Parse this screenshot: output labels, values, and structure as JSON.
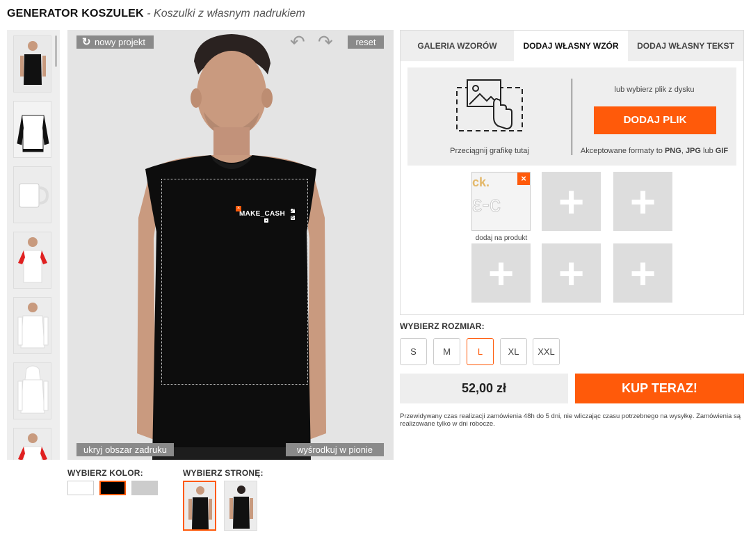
{
  "header": {
    "title": "GENERATOR KOSZULEK",
    "subtitle": "- Koszulki z własnym nadrukiem"
  },
  "preview": {
    "new_project": "nowy projekt",
    "reset": "reset",
    "hide_area": "ukryj obszar zadruku",
    "center_vertical": "wyśrodkuj w pionie",
    "design_text": "MAKE_CASH"
  },
  "options": {
    "color_label": "WYBIERZ KOLOR:",
    "colors": [
      "#ffffff",
      "#000000",
      "#cccccc"
    ],
    "side_label": "WYBIERZ STRONĘ:"
  },
  "tabs": [
    "GALERIA WZORÓW",
    "DODAJ WŁASNY WZÓR",
    "DODAJ WŁASNY TEKST"
  ],
  "upload": {
    "drag_label": "Przeciągnij grafikę tutaj",
    "or_label": "lub wybierz plik z dysku",
    "button": "DODAJ PLIK",
    "formats_prefix": "Akceptowane formaty to ",
    "png": "PNG",
    "sep1": ", ",
    "jpg": "JPG",
    "sep2": " lub ",
    "gif": "GIF",
    "slot_caption": "dodaj na produkt"
  },
  "size": {
    "label": "WYBIERZ ROZMIAR:",
    "options": [
      "S",
      "M",
      "L",
      "XL",
      "XXL"
    ],
    "selected": "L"
  },
  "price": "52,00 zł",
  "buy_button": "KUP TERAZ!",
  "note": "Przewidywany czas realizacji zamówienia 48h do 5 dni, nie wliczając czasu potrzebnego na wysyłkę. Zamówienia są realizowane tylko w dni robocze.",
  "colors": {
    "accent": "#ff5a0a"
  },
  "icons": [
    "refresh-icon",
    "undo-icon",
    "redo-icon",
    "image-drop-icon",
    "close-icon",
    "plus-icon"
  ]
}
